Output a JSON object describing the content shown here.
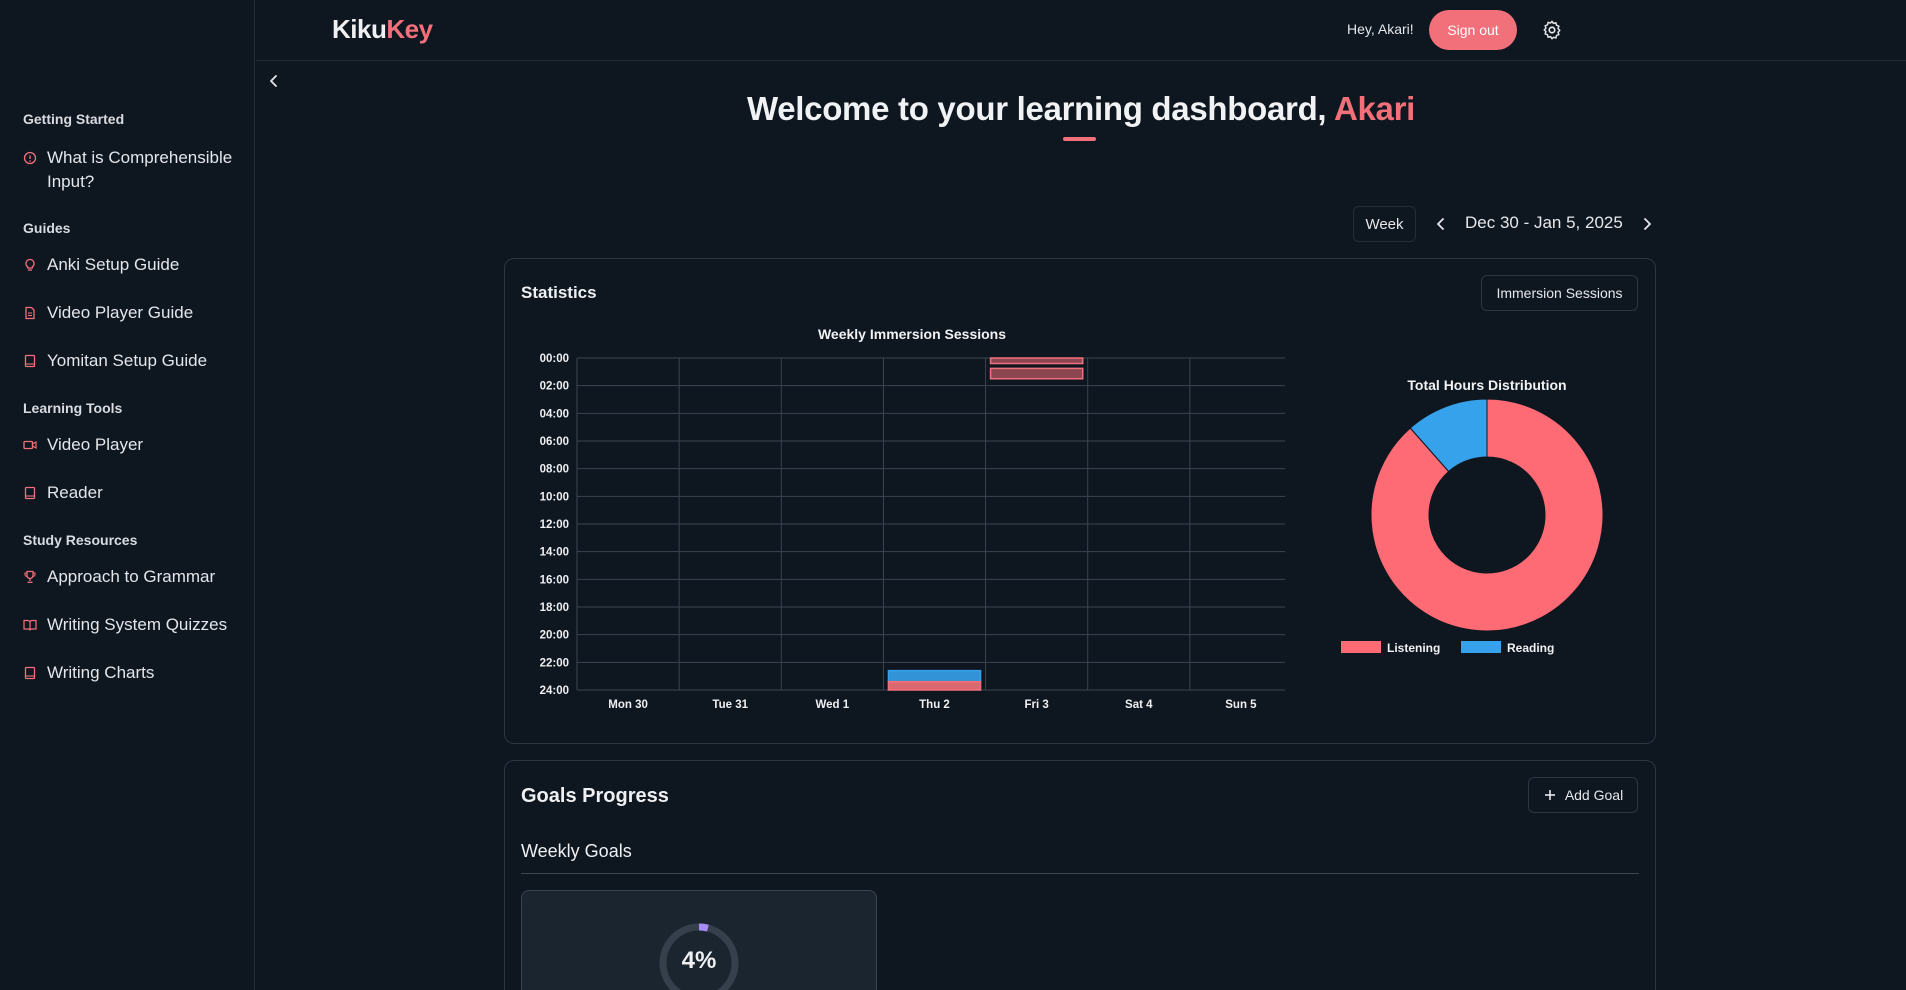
{
  "header": {
    "logo_part1": "Kiku",
    "logo_part2": "Key",
    "greeting": "Hey, Akari!",
    "sign_out": "Sign out"
  },
  "sidebar": {
    "sections": [
      {
        "title": "Getting Started",
        "items": [
          {
            "label": "What is Comprehensible Input?",
            "icon": "info-icon"
          }
        ]
      },
      {
        "title": "Guides",
        "items": [
          {
            "label": "Anki Setup Guide",
            "icon": "lightbulb-icon"
          },
          {
            "label": "Video Player Guide",
            "icon": "file-text-icon"
          },
          {
            "label": "Yomitan Setup Guide",
            "icon": "book-icon"
          }
        ]
      },
      {
        "title": "Learning Tools",
        "items": [
          {
            "label": "Video Player",
            "icon": "video-icon"
          },
          {
            "label": "Reader",
            "icon": "book-icon"
          }
        ]
      },
      {
        "title": "Study Resources",
        "items": [
          {
            "label": "Approach to Grammar",
            "icon": "trophy-icon"
          },
          {
            "label": "Writing System Quizzes",
            "icon": "book-open-icon"
          },
          {
            "label": "Writing Charts",
            "icon": "book-icon"
          }
        ]
      }
    ]
  },
  "welcome": {
    "prefix": "Welcome to your learning dashboard, ",
    "name": "Akari"
  },
  "date_controls": {
    "view": "Week",
    "range": "Dec 30 - Jan 5, 2025"
  },
  "statistics": {
    "title": "Statistics",
    "mode_button": "Immersion Sessions"
  },
  "chart_data": [
    {
      "type": "bar",
      "title": "Weekly Immersion Sessions",
      "categories": [
        "Mon 30",
        "Tue 31",
        "Wed 1",
        "Thu 2",
        "Fri 3",
        "Sat 4",
        "Sun 5"
      ],
      "y_ticks": [
        "00:00",
        "02:00",
        "04:00",
        "06:00",
        "08:00",
        "10:00",
        "12:00",
        "14:00",
        "16:00",
        "18:00",
        "20:00",
        "22:00",
        "24:00"
      ],
      "ylim": [
        0,
        24
      ],
      "y_reversed": true,
      "sessions": [
        {
          "day": "Thu 2",
          "type": "Reading",
          "start": 22.6,
          "end": 23.4
        },
        {
          "day": "Thu 2",
          "type": "Listening",
          "start": 23.4,
          "end": 24.0
        },
        {
          "day": "Fri 3",
          "type": "Listening",
          "start": 0.0,
          "end": 0.4
        },
        {
          "day": "Fri 3",
          "type": "Listening",
          "start": 0.75,
          "end": 1.5
        }
      ],
      "colors": {
        "Listening": "#f2707a",
        "Reading": "#36a2eb"
      }
    },
    {
      "type": "pie",
      "title": "Total Hours Distribution",
      "labels": [
        "Listening",
        "Reading"
      ],
      "values": [
        88.5,
        11.5
      ],
      "colors": [
        "#ff6b74",
        "#36a2eb"
      ],
      "legend": "bottom",
      "donut": true
    }
  ],
  "goals": {
    "title": "Goals Progress",
    "add_goal": "Add Goal",
    "weekly_title": "Weekly Goals",
    "goal_progress": "4%",
    "goal_progress_value": 4,
    "ring_color": "#a78bfa"
  }
}
